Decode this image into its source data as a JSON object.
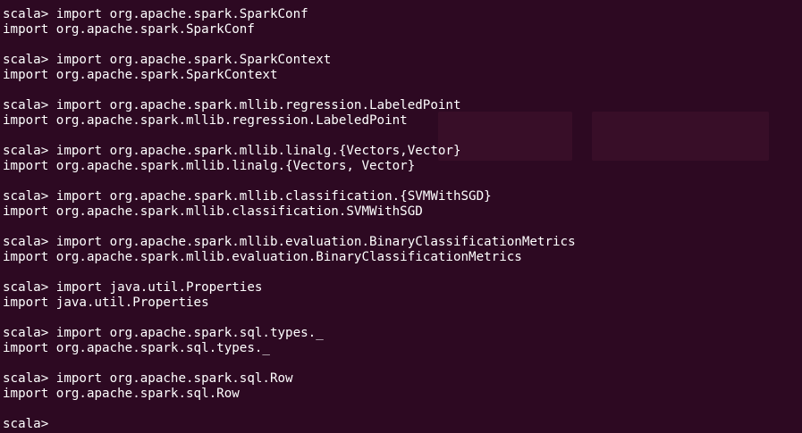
{
  "terminal": {
    "prompt": "scala>",
    "lines": [
      "scala> import org.apache.spark.SparkConf",
      "import org.apache.spark.SparkConf",
      "",
      "scala> import org.apache.spark.SparkContext",
      "import org.apache.spark.SparkContext",
      "",
      "scala> import org.apache.spark.mllib.regression.LabeledPoint",
      "import org.apache.spark.mllib.regression.LabeledPoint",
      "",
      "scala> import org.apache.spark.mllib.linalg.{Vectors,Vector}",
      "import org.apache.spark.mllib.linalg.{Vectors, Vector}",
      "",
      "scala> import org.apache.spark.mllib.classification.{SVMWithSGD}",
      "import org.apache.spark.mllib.classification.SVMWithSGD",
      "",
      "scala> import org.apache.spark.mllib.evaluation.BinaryClassificationMetrics",
      "import org.apache.spark.mllib.evaluation.BinaryClassificationMetrics",
      "",
      "scala> import java.util.Properties",
      "import java.util.Properties",
      "",
      "scala> import org.apache.spark.sql.types._",
      "import org.apache.spark.sql.types._",
      "",
      "scala> import org.apache.spark.sql.Row",
      "import org.apache.spark.sql.Row",
      "",
      "scala> "
    ]
  },
  "colors": {
    "background": "#2d0922",
    "foreground": "#ffffff"
  }
}
